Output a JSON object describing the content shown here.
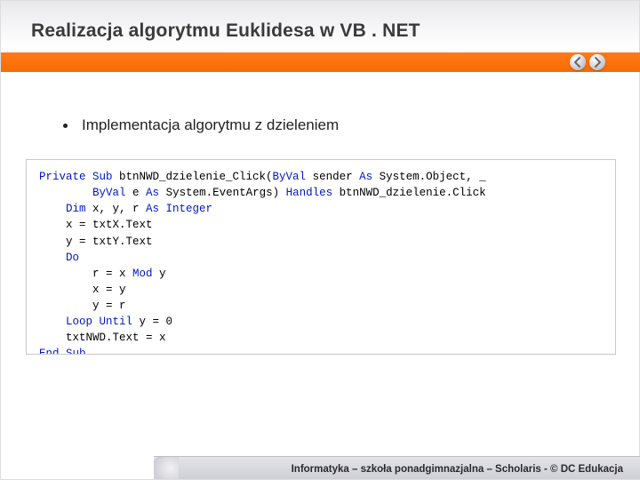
{
  "title": "Realizacja algorytmu Euklidesa w VB . NET",
  "bullet": "Implementacja algorytmu z dzieleniem",
  "code": {
    "l1a": "Private Sub",
    "l1b": " btnNWD_dzielenie_Click(",
    "l1c": "ByVal",
    "l1d": " sender ",
    "l1e": "As",
    "l1f": " System.Object, _",
    "l2a": "ByVal",
    "l2b": " e ",
    "l2c": "As",
    "l2d": " System.EventArgs) ",
    "l2e": "Handles",
    "l2f": " btnNWD_dzielenie.Click",
    "l3a": "Dim",
    "l3b": " x, y, r ",
    "l3c": "As Integer",
    "l4": "    x = txtX.Text",
    "l5": "    y = txtY.Text",
    "l6": "    Do",
    "l7a": "        r = x ",
    "l7b": "Mod",
    "l7c": " y",
    "l8": "        x = y",
    "l9": "        y = r",
    "l10a": "    Loop Until",
    "l10b": " y = 0",
    "l11": "    txtNWD.Text = x",
    "l12": "End Sub"
  },
  "footer": "Informatyka – szkoła ponadgimnazjalna – Scholaris - © DC Edukacja"
}
